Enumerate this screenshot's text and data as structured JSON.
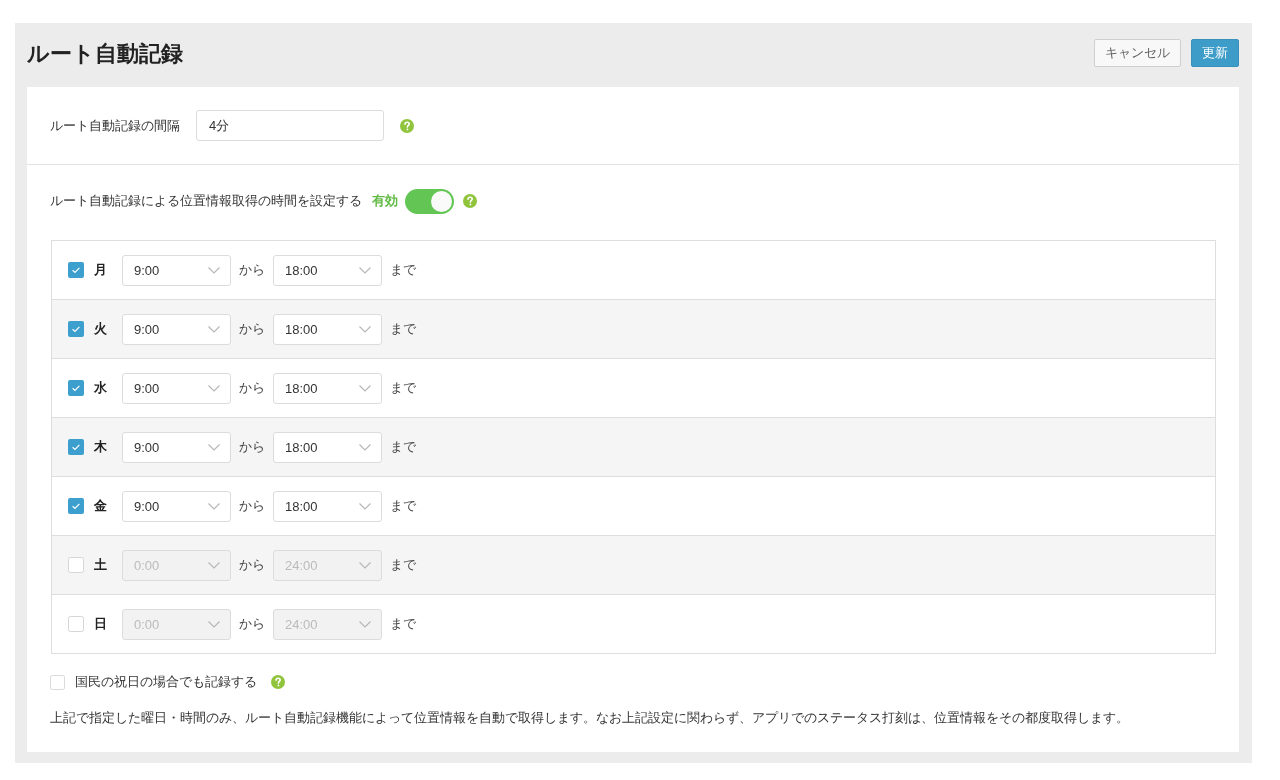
{
  "page": {
    "title": "ルート自動記録"
  },
  "buttons": [
    {
      "label": "キャンセル",
      "kind": "secondary"
    },
    {
      "label": "更新",
      "kind": "primary"
    }
  ],
  "interval": {
    "label": "ルート自動記録の間隔",
    "value": "4分"
  },
  "schedule": {
    "label": "ルート自動記録による位置情報取得の時間を設定する",
    "status": "有効",
    "on": true,
    "days": [
      {
        "day": "月",
        "checked": true,
        "from": "9:00",
        "from_word": "から",
        "to": "18:00",
        "to_word": "まで"
      },
      {
        "day": "火",
        "checked": true,
        "from": "9:00",
        "from_word": "から",
        "to": "18:00",
        "to_word": "まで"
      },
      {
        "day": "水",
        "checked": true,
        "from": "9:00",
        "from_word": "から",
        "to": "18:00",
        "to_word": "まで"
      },
      {
        "day": "木",
        "checked": true,
        "from": "9:00",
        "from_word": "から",
        "to": "18:00",
        "to_word": "まで"
      },
      {
        "day": "金",
        "checked": true,
        "from": "9:00",
        "from_word": "から",
        "to": "18:00",
        "to_word": "まで"
      },
      {
        "day": "土",
        "checked": false,
        "from": "0:00",
        "from_word": "から",
        "to": "24:00",
        "to_word": "まで"
      },
      {
        "day": "日",
        "checked": false,
        "from": "0:00",
        "from_word": "から",
        "to": "24:00",
        "to_word": "まで"
      }
    ]
  },
  "holiday": {
    "label": "国民の祝日の場合でも記録する",
    "checked": false
  },
  "note": "上記で指定した曜日・時間のみ、ルート自動記録機能によって位置情報を自動で取得します。なお上記設定に関わらず、アプリでのステータス打刻は、位置情報をその都度取得します。"
}
